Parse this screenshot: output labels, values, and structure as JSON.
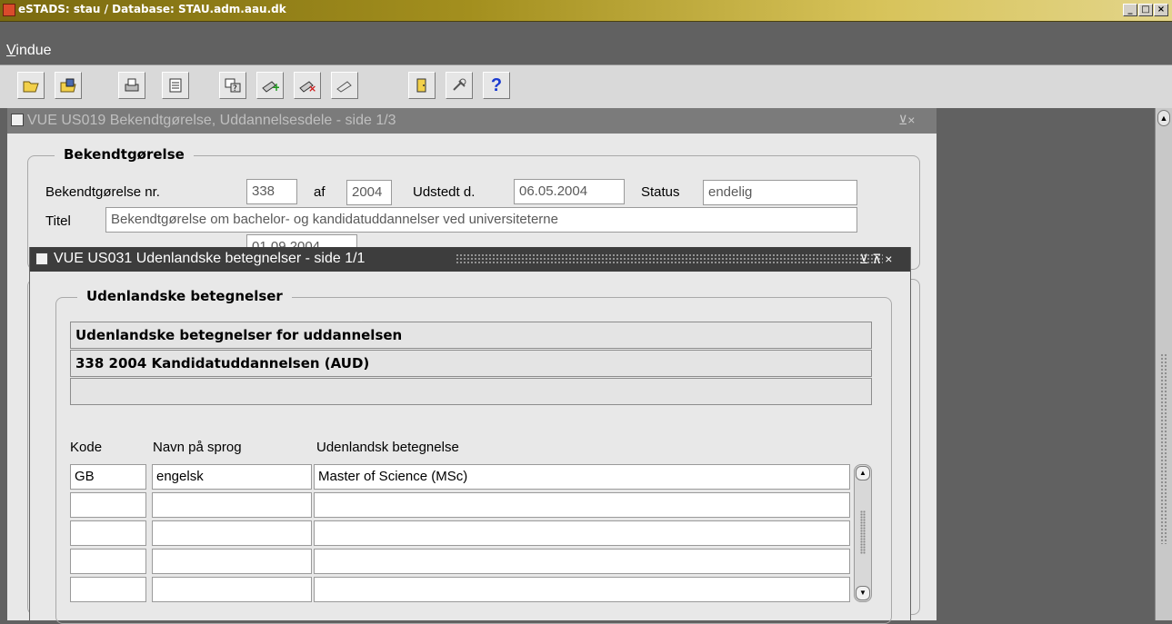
{
  "app": {
    "title": "eSTADS: stau / Database: STAU.adm.aau.dk"
  },
  "menu": {
    "vindue_accel": "V",
    "vindue_rest": "indue"
  },
  "toolbar": {
    "buttons": [
      "open-folder-icon",
      "save-icon",
      "print-icon",
      "document-icon",
      "query-icon",
      "insert-record-icon",
      "delete-record-icon",
      "clear-icon",
      "exit-icon",
      "tools-icon",
      "help-icon"
    ],
    "help_label": "?"
  },
  "main_window": {
    "title": "VUE US019 Bekendtgørelse, Uddannelsesdele - side 1/3",
    "controls": "⊻×",
    "group_title": "Bekendtgørelse",
    "nr_label": "Bekendtgørelse nr.",
    "nr_value": "338",
    "af_label": "af",
    "year_value": "2004",
    "udstedt_label": "Udstedt d.",
    "udstedt_value": "06.05.2004",
    "status_label": "Status",
    "status_value": "endelig",
    "titel_label": "Titel",
    "titel_value": "Bekendtgørelse om bachelor- og kandidatuddannelser ved universiteterne",
    "ikraft_value": "01.09.2004"
  },
  "dialog": {
    "title": "VUE US031 Udenlandske betegnelser -  side 1/1",
    "controls": "⊻ ⊼ ×",
    "group_title": "Udenlandske betegnelser",
    "info_line1": "Udenlandske betegnelser for uddannelsen",
    "info_line2": "338 2004 Kandidatuddannelsen (AUD)",
    "info_line3": "",
    "col_kode": "Kode",
    "col_sprog": "Navn på sprog",
    "col_betegnelse": "Udenlandsk betegnelse",
    "rows": [
      {
        "kode": "GB",
        "sprog": "engelsk",
        "betegnelse": "Master of Science (MSc)"
      },
      {
        "kode": "",
        "sprog": "",
        "betegnelse": ""
      },
      {
        "kode": "",
        "sprog": "",
        "betegnelse": ""
      },
      {
        "kode": "",
        "sprog": "",
        "betegnelse": ""
      },
      {
        "kode": "",
        "sprog": "",
        "betegnelse": ""
      }
    ]
  },
  "colors": {
    "titlebar_start": "#7a6a10",
    "titlebar_end": "#e3d58a",
    "workspace": "#616161",
    "dialog_caption": "#3d3d3d"
  }
}
